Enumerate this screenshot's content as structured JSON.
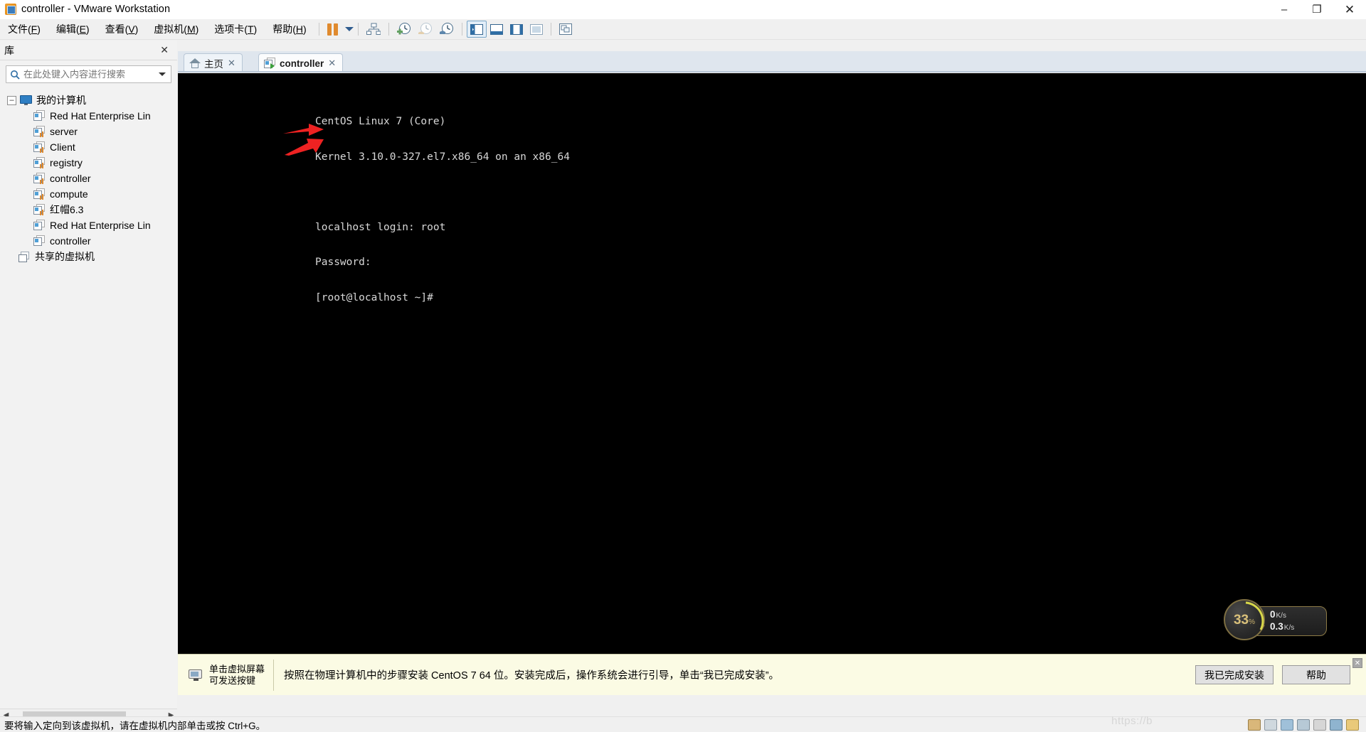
{
  "window": {
    "title": "controller - VMware Workstation",
    "app_icon": "vmware-icon",
    "minimize": "–",
    "maximize": "❐",
    "close": "✕"
  },
  "menu": {
    "items": [
      {
        "label": "文件(F)",
        "mnemonic": "F",
        "text_before": "文件(",
        "text_after": ")"
      },
      {
        "label": "编辑(E)",
        "mnemonic": "E",
        "text_before": "编辑(",
        "text_after": ")"
      },
      {
        "label": "查看(V)",
        "mnemonic": "V",
        "text_before": "查看(",
        "text_after": ")"
      },
      {
        "label": "虚拟机(M)",
        "mnemonic": "M",
        "text_before": "虚拟机(",
        "text_after": ")"
      },
      {
        "label": "选项卡(T)",
        "mnemonic": "T",
        "text_before": "选项卡(",
        "text_after": ")"
      },
      {
        "label": "帮助(H)",
        "mnemonic": "H",
        "text_before": "帮助(",
        "text_after": ")"
      }
    ]
  },
  "toolbar": {
    "icons": [
      "pause-button",
      "dropdown-caret",
      "network-adapter-icon",
      "snapshot-take-icon",
      "snapshot-revert-icon",
      "snapshot-manager-icon",
      "show-library-toggle",
      "show-console-view-icon",
      "show-thumbnails-icon",
      "show-fullscreen-icon",
      "unity-mode-icon"
    ]
  },
  "library": {
    "title": "库",
    "close_label": "✕",
    "search": {
      "placeholder": "在此处键入内容进行搜索",
      "value": "",
      "icon": "search-icon",
      "dropdown_icon": "chevron-down-icon"
    },
    "tree": {
      "root": {
        "label": "我的计算机",
        "expander": "–",
        "icon": "my-computer-icon"
      },
      "children": [
        {
          "label": "Red Hat Enterprise Lin",
          "icon": "vm-icon",
          "powered": false
        },
        {
          "label": "server",
          "icon": "vm-icon",
          "powered": true
        },
        {
          "label": "Client",
          "icon": "vm-icon",
          "powered": true
        },
        {
          "label": "registry",
          "icon": "vm-icon",
          "powered": true
        },
        {
          "label": "controller",
          "icon": "vm-icon",
          "powered": true
        },
        {
          "label": "compute",
          "icon": "vm-icon",
          "powered": true
        },
        {
          "label": "红帽6.3",
          "icon": "vm-icon",
          "powered": true
        },
        {
          "label": "Red Hat Enterprise Lin",
          "icon": "vm-icon",
          "powered": false
        },
        {
          "label": "controller",
          "icon": "vm-icon",
          "powered": false
        }
      ],
      "shared": {
        "label": "共享的虚拟机",
        "icon": "shared-vms-icon"
      }
    }
  },
  "tabs": [
    {
      "label": "主页",
      "icon": "home-icon",
      "close": "✕",
      "active": false
    },
    {
      "label": "controller",
      "icon": "vm-running-icon",
      "close": "✕",
      "active": true
    }
  ],
  "console": {
    "lines": [
      "CentOS Linux 7 (Core)",
      "Kernel 3.10.0-327.el7.x86_64 on an x86_64",
      "",
      "localhost login: root",
      "Password:",
      "[root@localhost ~]#"
    ],
    "annotations": [
      {
        "name": "arrow-login",
        "color": "#ee2222"
      },
      {
        "name": "arrow-password",
        "color": "#ee2222"
      }
    ],
    "perf_widget": {
      "cpu_percent": "33",
      "percent_symbol": "%",
      "upload": {
        "value": "0",
        "unit": "K/s",
        "arrow": "up"
      },
      "download": {
        "value": "0.3",
        "unit": "K/s",
        "arrow": "down"
      }
    }
  },
  "notification": {
    "hint_line1": "单击虚拟屏幕",
    "hint_line2": "可发送按键",
    "message": "按照在物理计算机中的步骤安装 CentOS 7 64 位。安装完成后，操作系统会进行引导，单击“我已完成安装”。",
    "primary_button": "我已完成安装",
    "secondary_button": "帮助",
    "close_label": "✕"
  },
  "statusbar": {
    "text": "要将输入定向到该虚拟机，请在虚拟机内部单击或按 Ctrl+G。",
    "watermark": "https://b",
    "tray_icons": [
      "device-floppy-icon",
      "device-cd-icon",
      "device-network-icon",
      "device-usb-icon",
      "device-printer-icon",
      "device-display-icon",
      "device-folder-icon"
    ]
  },
  "colors": {
    "accent": "#e08a2e",
    "console_bg": "#000000",
    "console_fg": "#d8d8d8",
    "notify_bg": "#fbfbe4",
    "annotation": "#ee2222",
    "chrome": "#f0f0f0"
  }
}
